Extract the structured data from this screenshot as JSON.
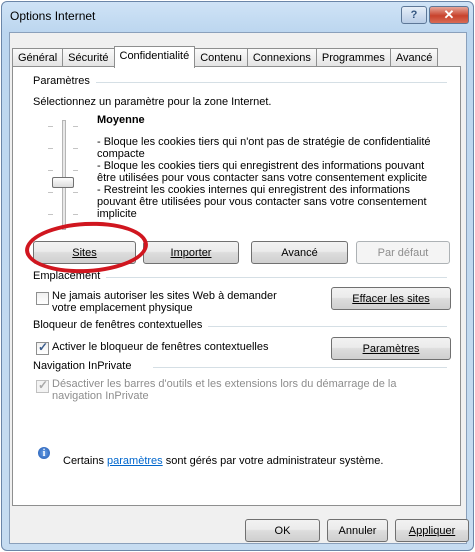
{
  "window": {
    "title": "Options Internet",
    "help_icon": "question-mark-icon",
    "close_icon": "close-icon"
  },
  "tabs": [
    "Général",
    "Sécurité",
    "Confidentialité",
    "Contenu",
    "Connexions",
    "Programmes",
    "Avancé"
  ],
  "active_tab": "Confidentialité",
  "parametres": {
    "heading": "Paramètres",
    "instruction": "Sélectionnez un paramètre pour la zone Internet.",
    "level": "Moyenne",
    "level_fraction": 0.5,
    "description": [
      "- Bloque les cookies tiers qui n'ont pas de stratégie de confidentialité compacte",
      "- Bloque les cookies tiers qui enregistrent des informations pouvant être utilisées pour vous contacter sans votre consentement explicite",
      "- Restreint les cookies internes qui enregistrent des informations pouvant être utilisées pour vous contacter sans votre consentement implicite"
    ],
    "buttons": {
      "sites": "Sites",
      "importer": "Importer",
      "avance": "Avancé",
      "defaut": "Par défaut"
    }
  },
  "emplacement": {
    "heading": "Emplacement",
    "checkbox_label": "Ne jamais autoriser les sites Web à demander votre emplacement physique",
    "checked": false,
    "clear_button": "Effacer les sites"
  },
  "bloqueur": {
    "heading": "Bloqueur de fenêtres contextuelles",
    "checkbox_label": "Activer le bloqueur de fenêtres contextuelles",
    "checked": true,
    "settings_button": "Paramètres"
  },
  "inprivate": {
    "heading": "Navigation InPrivate",
    "checkbox_label": "Désactiver les barres d'outils et les extensions lors du démarrage de la navigation InPrivate",
    "checked": true,
    "disabled": true
  },
  "info": {
    "icon": "info-icon",
    "text_before": "Certains ",
    "link": "paramètres",
    "text_after": " sont gérés par votre administrateur système."
  },
  "footer": {
    "ok": "OK",
    "annuler": "Annuler",
    "appliquer": "Appliquer"
  },
  "annotation_color": "#d0161f"
}
